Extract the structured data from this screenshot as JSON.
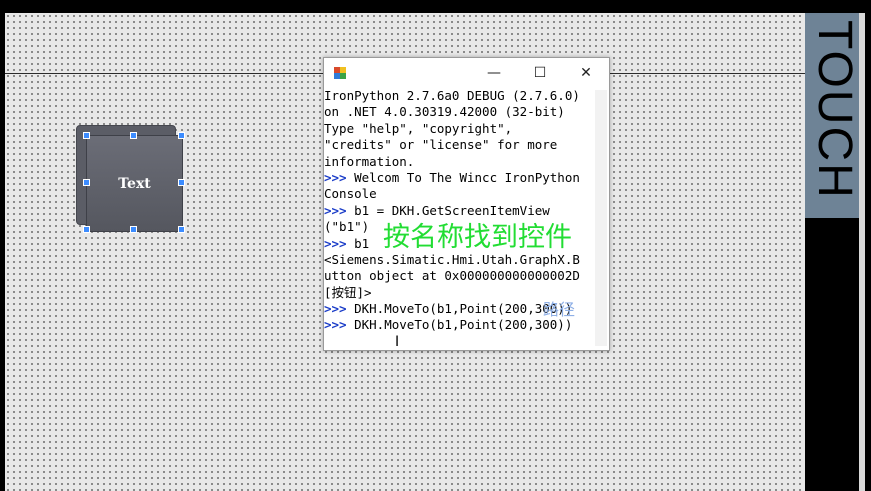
{
  "canvas": {
    "button_text": "Text"
  },
  "side": {
    "label": "TOUCH"
  },
  "console": {
    "window_controls": {
      "minimize": "—",
      "maximize": "☐",
      "close": "✕"
    },
    "lines": [
      "IronPython 2.7.6a0 DEBUG (2.7.6.0)",
      "on .NET 4.0.30319.42000 (32-bit)",
      "Type \"help\", \"copyright\",",
      "\"credits\" or \"license\" for more",
      "information.",
      ">>> Welcom To The Wincc IronPython",
      "Console",
      ">>> b1 = DKH.GetScreenItemView",
      "(\"b1\")",
      ">>> b1",
      "<Siemens.Simatic.Hmi.Utah.GraphX.B",
      "utton object at 0x000000000000002D",
      "[按钮]>",
      ">>> DKH.MoveTo(b1,Point(200,300))",
      ">>> DKH.MoveTo(b1,Point(200,300))"
    ]
  },
  "overlays": {
    "caption_cn": "按名称找到控件",
    "caption_path": "路径"
  },
  "colors": {
    "caption_green": "#22dd33",
    "touch_strip": "#6e8396"
  }
}
